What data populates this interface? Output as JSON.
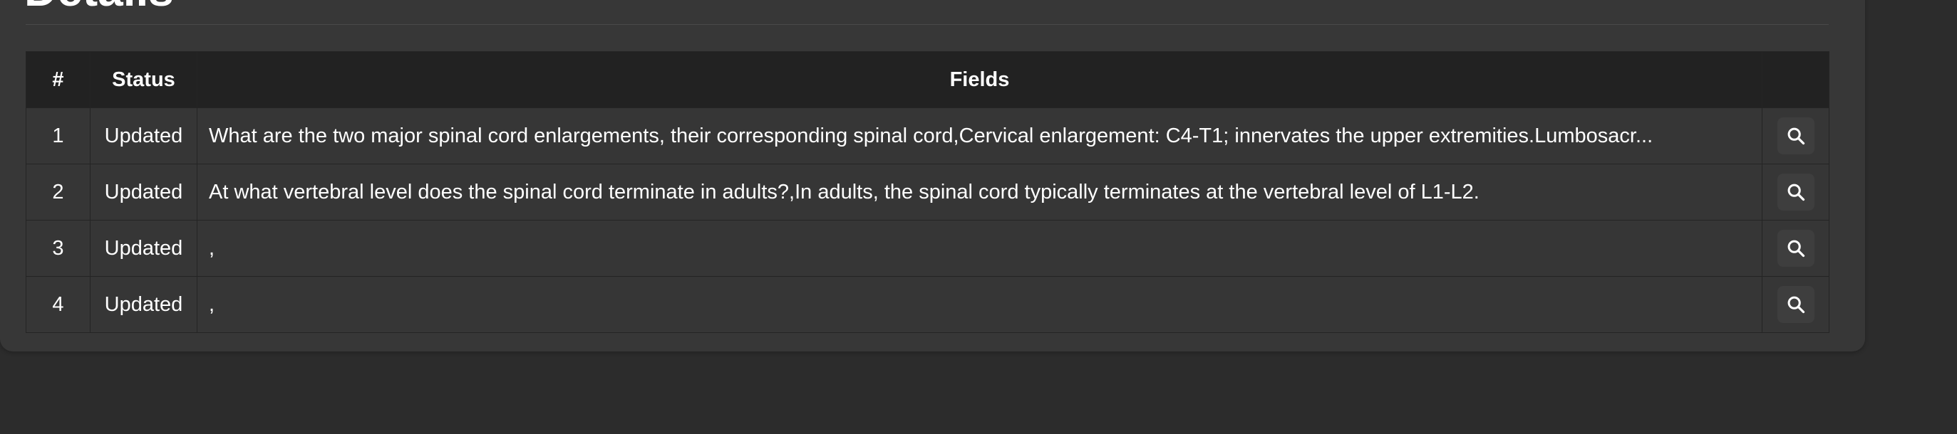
{
  "page": {
    "heading": "Details"
  },
  "table": {
    "columns": [
      "#",
      "Status",
      "Fields",
      ""
    ],
    "rows": [
      {
        "num": "1",
        "status": "Updated",
        "fields": "What are the two major spinal cord enlargements, their corresponding spinal cord,Cervical enlargement: C4-T1; innervates the upper extremities.Lumbosacr...",
        "action_icon": "search-icon"
      },
      {
        "num": "2",
        "status": "Updated",
        "fields": "At what vertebral level does the spinal cord terminate in adults?,In adults, the spinal cord typically terminates at the vertebral level of L1-L2.",
        "action_icon": "search-icon"
      },
      {
        "num": "3",
        "status": "Updated",
        "fields": ",",
        "action_icon": "search-icon"
      },
      {
        "num": "4",
        "status": "Updated",
        "fields": ",",
        "action_icon": "search-icon"
      }
    ]
  },
  "colors": {
    "page_bg": "#2c2c2c",
    "panel_bg": "#373737",
    "header_bg": "#222222",
    "text": "#ffffff"
  }
}
